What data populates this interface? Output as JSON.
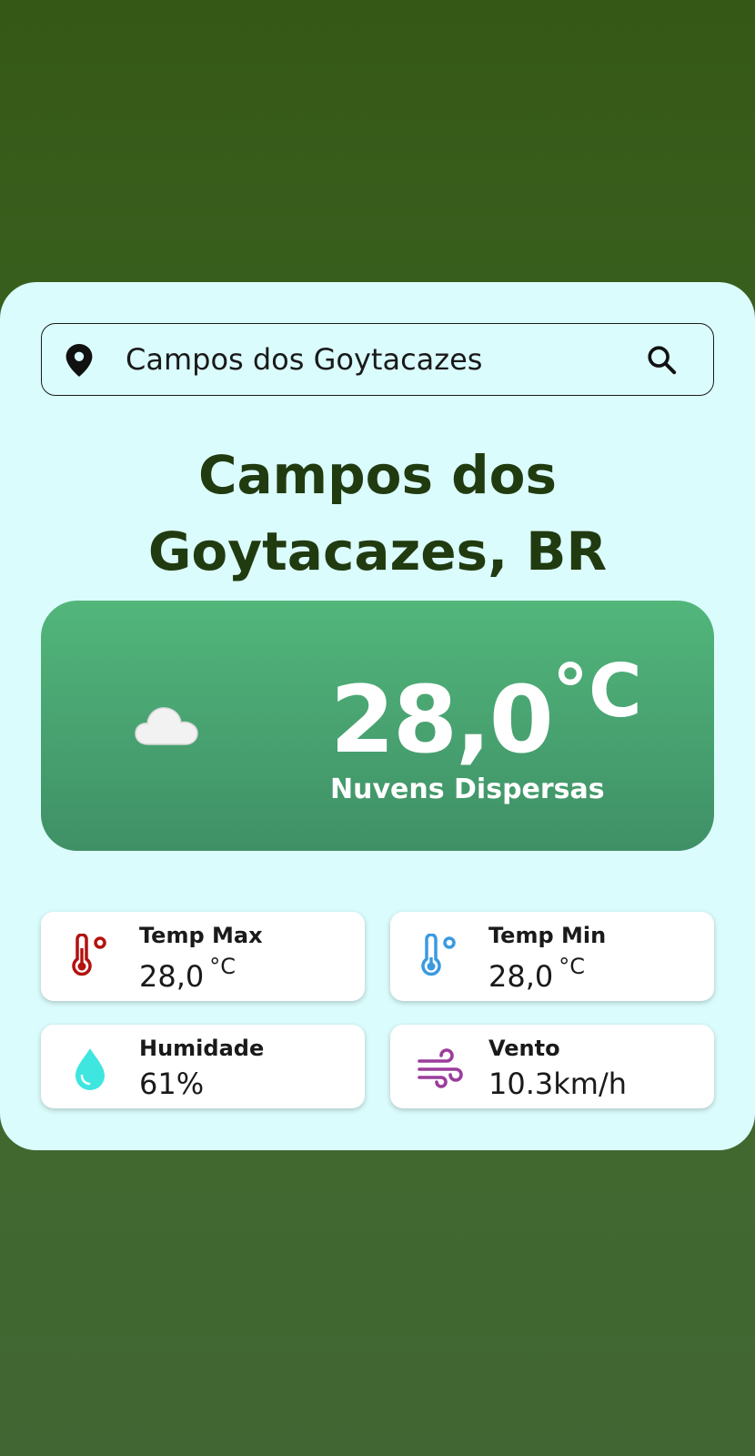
{
  "search": {
    "value": "Campos dos Goytacazes",
    "location_icon": "map-pin-icon",
    "search_icon": "search-icon"
  },
  "city": {
    "line1": "Campos dos",
    "line2": "Goytacazes, BR"
  },
  "current": {
    "icon": "cloud-icon",
    "temperature": "28,0",
    "unit": "°C",
    "description": "Nuvens Dispersas"
  },
  "stats": {
    "temp_max": {
      "label": "Temp Max",
      "value": "28,0",
      "unit": "°C",
      "icon": "thermometer-hot-icon",
      "color": "#b3120f"
    },
    "temp_min": {
      "label": "Temp Min",
      "value": "28,0",
      "unit": "°C",
      "icon": "thermometer-cold-icon",
      "color": "#3a9ae0"
    },
    "humidity": {
      "label": "Humidade",
      "value": "61%",
      "icon": "water-drop-icon",
      "color": "#3ee6df"
    },
    "wind": {
      "label": "Vento",
      "value": "10.3km/h",
      "icon": "wind-icon",
      "color": "#9b3c9c"
    }
  },
  "colors": {
    "background": "#365816",
    "card": "#dbfcfc",
    "title": "#213b10",
    "main_box": "#4aa672"
  }
}
